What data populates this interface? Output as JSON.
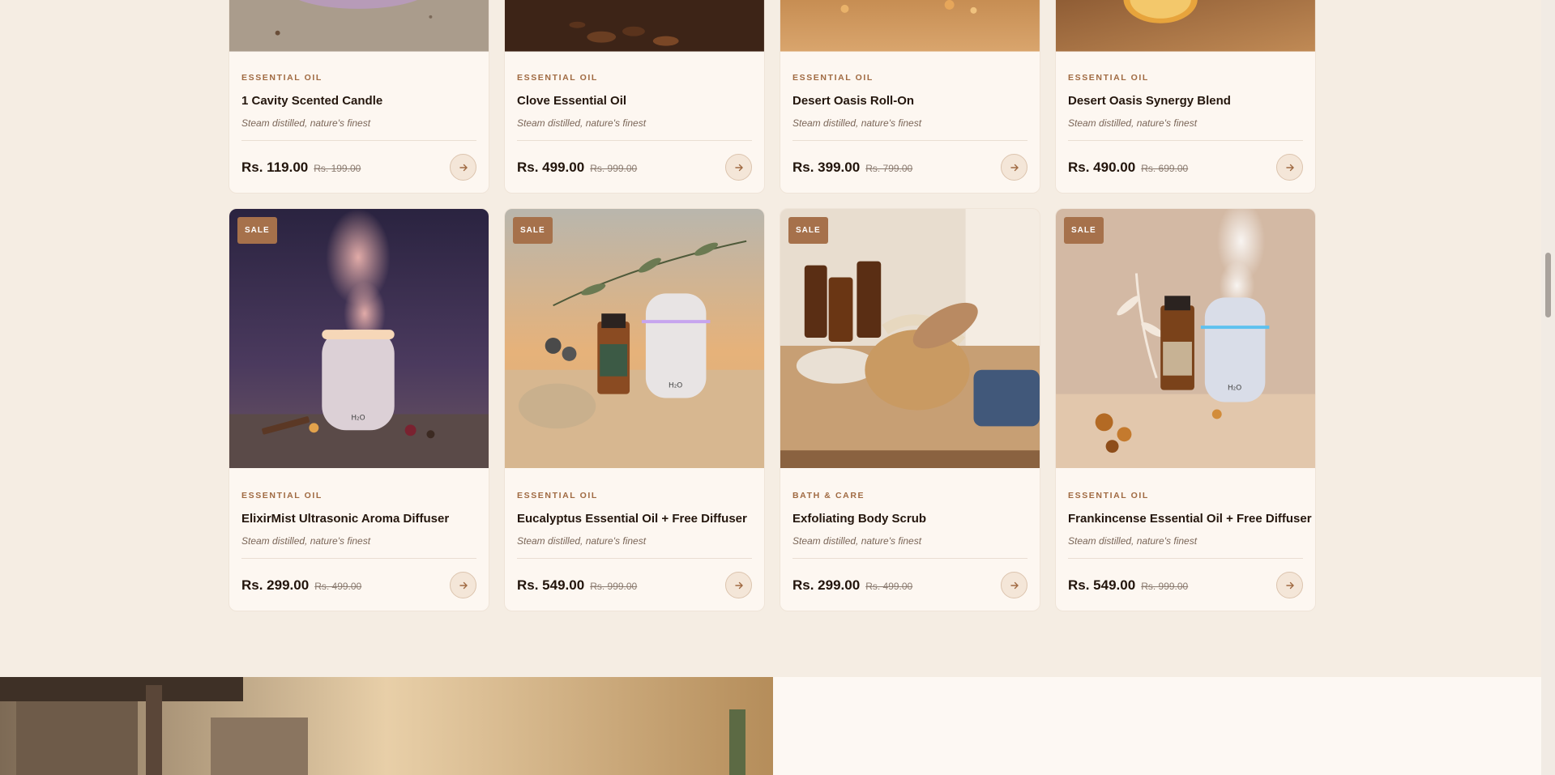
{
  "row1": [
    {
      "category": "ESSENTIAL OIL",
      "name": "1 Cavity Scented Candle",
      "desc": "Steam distilled, nature's finest",
      "price": "Rs. 119.00",
      "old_price": "Rs. 199.00"
    },
    {
      "category": "ESSENTIAL OIL",
      "name": "Clove Essential Oil",
      "desc": "Steam distilled, nature's finest",
      "price": "Rs. 499.00",
      "old_price": "Rs. 999.00"
    },
    {
      "category": "ESSENTIAL OIL",
      "name": "Desert Oasis Roll-On",
      "desc": "Steam distilled, nature's finest",
      "price": "Rs. 399.00",
      "old_price": "Rs. 799.00"
    },
    {
      "category": "ESSENTIAL OIL",
      "name": "Desert Oasis Synergy Blend",
      "desc": "Steam distilled, nature's finest",
      "price": "Rs. 490.00",
      "old_price": "Rs. 699.00"
    }
  ],
  "row2": [
    {
      "badge": "SALE",
      "category": "ESSENTIAL OIL",
      "name": "ElixirMist Ultrasonic Aroma Diffuser",
      "desc": "Steam distilled, nature's finest",
      "price": "Rs. 299.00",
      "old_price": "Rs. 499.00",
      "photo": "diffuser-dusk-photo"
    },
    {
      "badge": "SALE",
      "category": "ESSENTIAL OIL",
      "name": "Eucalyptus Essential Oil + Free Diffuser",
      "desc": "Steam distilled, nature's finest",
      "price": "Rs. 549.00",
      "old_price": "Rs. 999.00",
      "photo": "eucalyptus-diffuser-photo"
    },
    {
      "badge": "SALE",
      "category": "BATH & CARE",
      "name": "Exfoliating Body Scrub",
      "desc": "Steam distilled, nature's finest",
      "price": "Rs. 299.00",
      "old_price": "Rs. 499.00",
      "photo": "body-scrub-brush-photo"
    },
    {
      "badge": "SALE",
      "category": "ESSENTIAL OIL",
      "name": "Frankincense Essential Oil + Free Diffuser",
      "desc": "Steam distilled, nature's finest",
      "price": "Rs. 549.00",
      "old_price": "Rs. 999.00",
      "photo": "frankincense-diffuser-photo"
    }
  ],
  "colors": {
    "accent": "#a6714b",
    "background": "#f5ede3",
    "card": "#fdf7f1"
  },
  "icons": {
    "card_action": "arrow-right-icon"
  }
}
